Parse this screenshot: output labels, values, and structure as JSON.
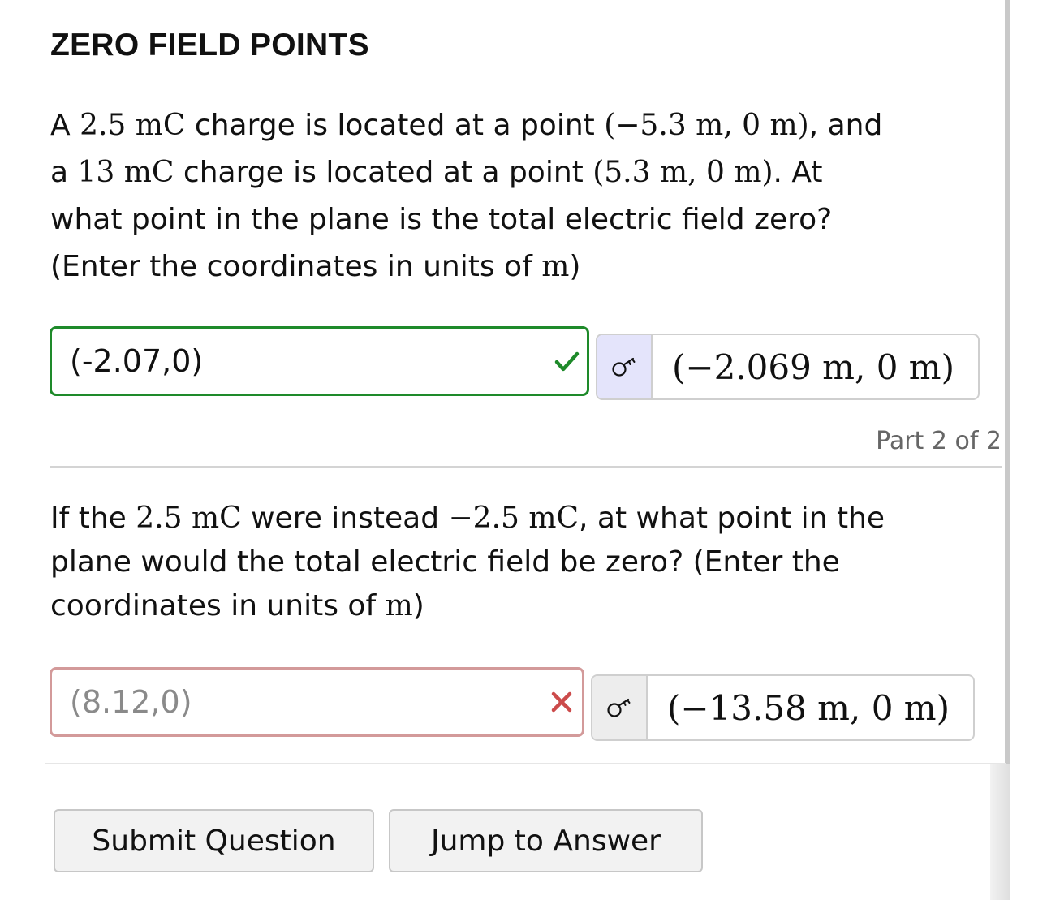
{
  "title": "ZERO FIELD POINTS",
  "part1": {
    "question_lines": [
      [
        {
          "t": "A ",
          "m": false
        },
        {
          "t": "2.5 mC",
          "m": true
        },
        {
          "t": " charge is located at a point ",
          "m": false
        },
        {
          "t": "(−5.3 m, 0 m)",
          "m": true
        },
        {
          "t": ", and",
          "m": false
        }
      ],
      [
        {
          "t": "a ",
          "m": false
        },
        {
          "t": "13 mC",
          "m": true
        },
        {
          "t": " charge is located at a point ",
          "m": false
        },
        {
          "t": "(5.3 m, 0 m)",
          "m": true
        },
        {
          "t": ". At",
          "m": false
        }
      ],
      [
        {
          "t": "what point in the plane is the total electric field zero?",
          "m": false
        }
      ],
      [
        {
          "t": "(Enter the coordinates in units of ",
          "m": false
        },
        {
          "t": "m",
          "m": true
        },
        {
          "t": ")",
          "m": false
        }
      ]
    ],
    "answer_value": "(-2.07,0)",
    "answer_status": "correct",
    "status_icon": "checkmark-icon",
    "preview_icon": "key-icon",
    "preview_value": "(−2.069 m, 0 m)"
  },
  "part_label": "Part 2 of 2",
  "part2": {
    "question_lines": [
      [
        {
          "t": "If the ",
          "m": false
        },
        {
          "t": "2.5 mC",
          "m": true
        },
        {
          "t": " were instead ",
          "m": false
        },
        {
          "t": "−2.5 mC",
          "m": true
        },
        {
          "t": ", at what point in the",
          "m": false
        }
      ],
      [
        {
          "t": "plane would the total electric field be zero? (Enter the",
          "m": false
        }
      ],
      [
        {
          "t": "coordinates in units of ",
          "m": false
        },
        {
          "t": "m",
          "m": true
        },
        {
          "t": ")",
          "m": false
        }
      ]
    ],
    "answer_value": "(8.12,0)",
    "answer_status": "incorrect",
    "status_icon": "x-mark-icon",
    "preview_icon": "key-icon",
    "preview_value": "(−13.58 m, 0 m)"
  },
  "buttons": {
    "submit_label": "Submit Question",
    "jump_label": "Jump to Answer"
  },
  "colors": {
    "correct": "#1e8a2a",
    "incorrect_border": "#d39a9a",
    "incorrect_mark": "#cc4b4b",
    "preview_active_bg": "#e4e4fb"
  }
}
